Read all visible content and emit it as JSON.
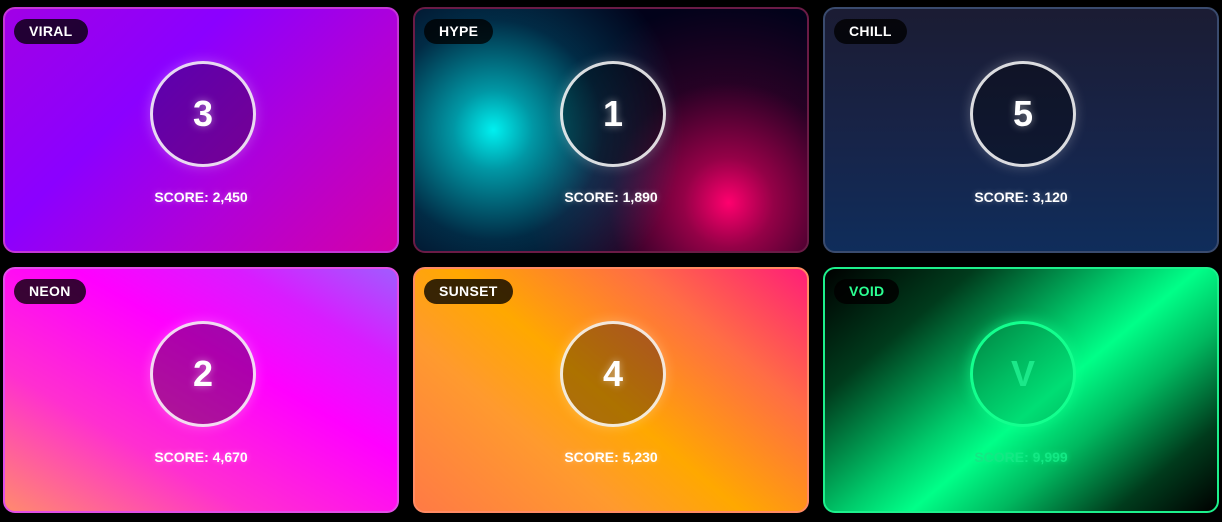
{
  "cards": [
    {
      "theme": "viral",
      "tag": "VIRAL",
      "rank": "3",
      "score": "SCORE: 2,450"
    },
    {
      "theme": "hype",
      "tag": "HYPE",
      "rank": "1",
      "score": "SCORE: 1,890"
    },
    {
      "theme": "chill",
      "tag": "CHILL",
      "rank": "5",
      "score": "SCORE: 3,120"
    },
    {
      "theme": "neon",
      "tag": "NEON",
      "rank": "2",
      "score": "SCORE: 4,670"
    },
    {
      "theme": "sunset",
      "tag": "SUNSET",
      "rank": "4",
      "score": "SCORE: 5,230"
    },
    {
      "theme": "void",
      "tag": "VOID",
      "rank": "V",
      "score": "SCORE: 9,999"
    }
  ],
  "colors": {
    "background": "#000000",
    "void_accent": "#13ff8e"
  }
}
